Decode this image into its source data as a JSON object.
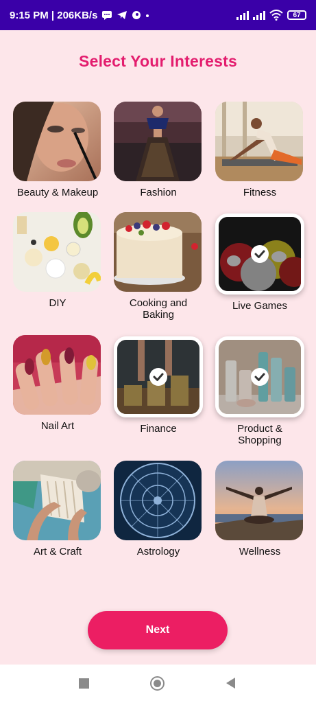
{
  "status_bar": {
    "time": "9:15 PM | 206KB/s",
    "battery": "67"
  },
  "title": "Select Your Interests",
  "interests": [
    {
      "label": "Beauty & Makeup",
      "selected": false
    },
    {
      "label": "Fashion",
      "selected": false
    },
    {
      "label": "Fitness",
      "selected": false
    },
    {
      "label": "DIY",
      "selected": false
    },
    {
      "label": "Cooking and Baking",
      "selected": false
    },
    {
      "label": "Live Games",
      "selected": true
    },
    {
      "label": "Nail Art",
      "selected": false
    },
    {
      "label": "Finance",
      "selected": true
    },
    {
      "label": "Product & Shopping",
      "selected": true
    },
    {
      "label": "Art & Craft",
      "selected": false
    },
    {
      "label": "Astrology",
      "selected": false
    },
    {
      "label": "Wellness",
      "selected": false
    }
  ],
  "next_button": "Next",
  "colors": {
    "accent": "#ec1e63",
    "title": "#e31d6e",
    "background": "#fde6ea",
    "status_bar": "#3a00a8"
  }
}
